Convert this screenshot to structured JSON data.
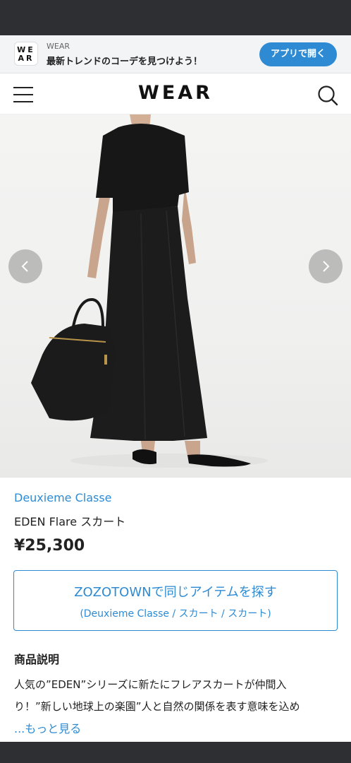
{
  "app_banner": {
    "logo_text": "WE AR",
    "brand": "WEAR",
    "tagline": "最新トレンドのコーデを見つけよう！",
    "open_button": "アプリで開く"
  },
  "header": {
    "logo": "WEAR",
    "icons": [
      "menu-icon",
      "search-icon"
    ]
  },
  "carousel": {
    "icons": [
      "chevron-left-icon",
      "chevron-right-icon"
    ]
  },
  "product": {
    "brand": "Deuxieme Classe",
    "name": "EDEN Flare スカート",
    "price": "¥25,300"
  },
  "zozo_button": {
    "main": "ZOZOTOWNで同じアイテムを探す",
    "sub": "(Deuxieme Classe / スカート / スカート)"
  },
  "description": {
    "heading": "商品説明",
    "line1": "人気の”EDEN”シリーズに新たにフレアスカートが仲間入",
    "line2": "り！”新しい地球上の楽園”人と自然の関係を表す意味を込め",
    "more": "...もっと見る"
  },
  "colors": {
    "accent": "#2e8bd3",
    "status_bar": "#2d2f33"
  }
}
